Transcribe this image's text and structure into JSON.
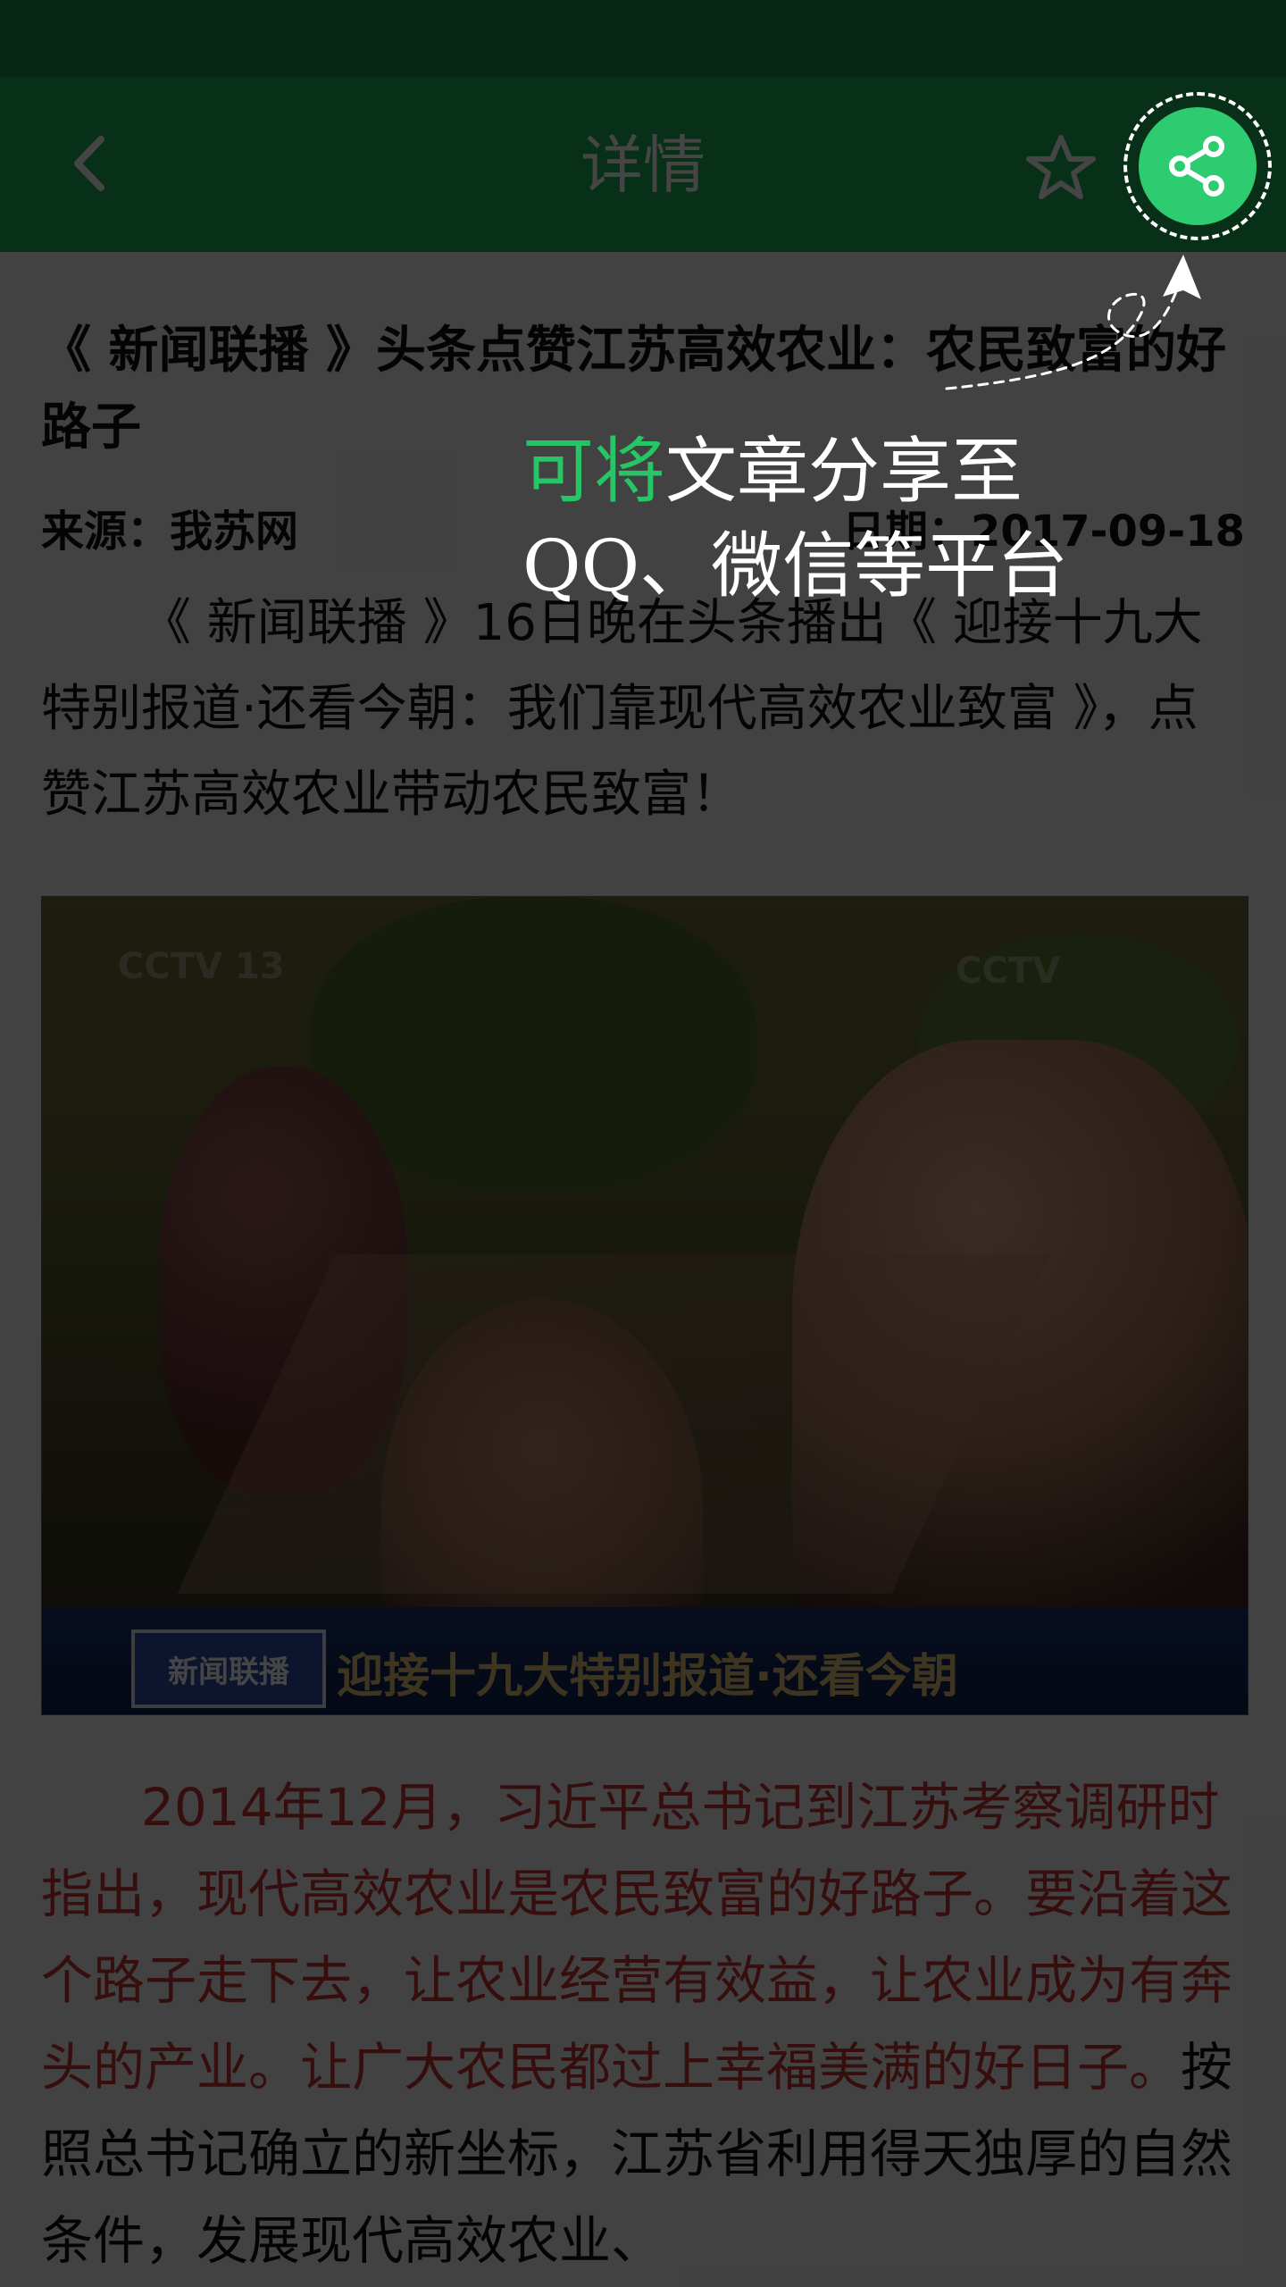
{
  "header": {
    "title": "详情",
    "back_icon": "chevron-left-icon",
    "favorite_icon": "star-outline-icon",
    "share_icon": "share-icon",
    "color": "#1fb35a"
  },
  "article": {
    "title": "《 新闻联播 》头条点赞江苏高效农业：农民致富的好路子",
    "source": "来源：我苏网",
    "date": "日期：2017-09-18",
    "para1": "《 新闻联播 》16日晚在头条播出《 迎接十九大特别报道·还看今朝：我们靠现代高效农业致富 》，点赞江苏高效农业带动农民致富！",
    "image": {
      "watermark_left": "CCTV 13",
      "watermark_right": "CCTV",
      "logo_text": "新闻联播",
      "caption": "迎接十九大特别报道·还看今朝"
    },
    "para2_highlight": "2014年12月，习近平总书记到江苏考察调研时指出，现代高效农业是农民致富的好路子。要沿着这个路子走下去，让农业经营有效益，让农业成为有奔头的产业。让广大农民都过上幸福美满的好日子。",
    "para2_rest": "按照总书记确立的新坐标，江苏省利用得天独厚的自然条件，发展现代高效农业、"
  },
  "guide": {
    "text_highlight": "可将",
    "text_line1_rest": "文章分享至",
    "text_line2": "QQ、微信等平台",
    "highlight_color": "#27c565"
  }
}
